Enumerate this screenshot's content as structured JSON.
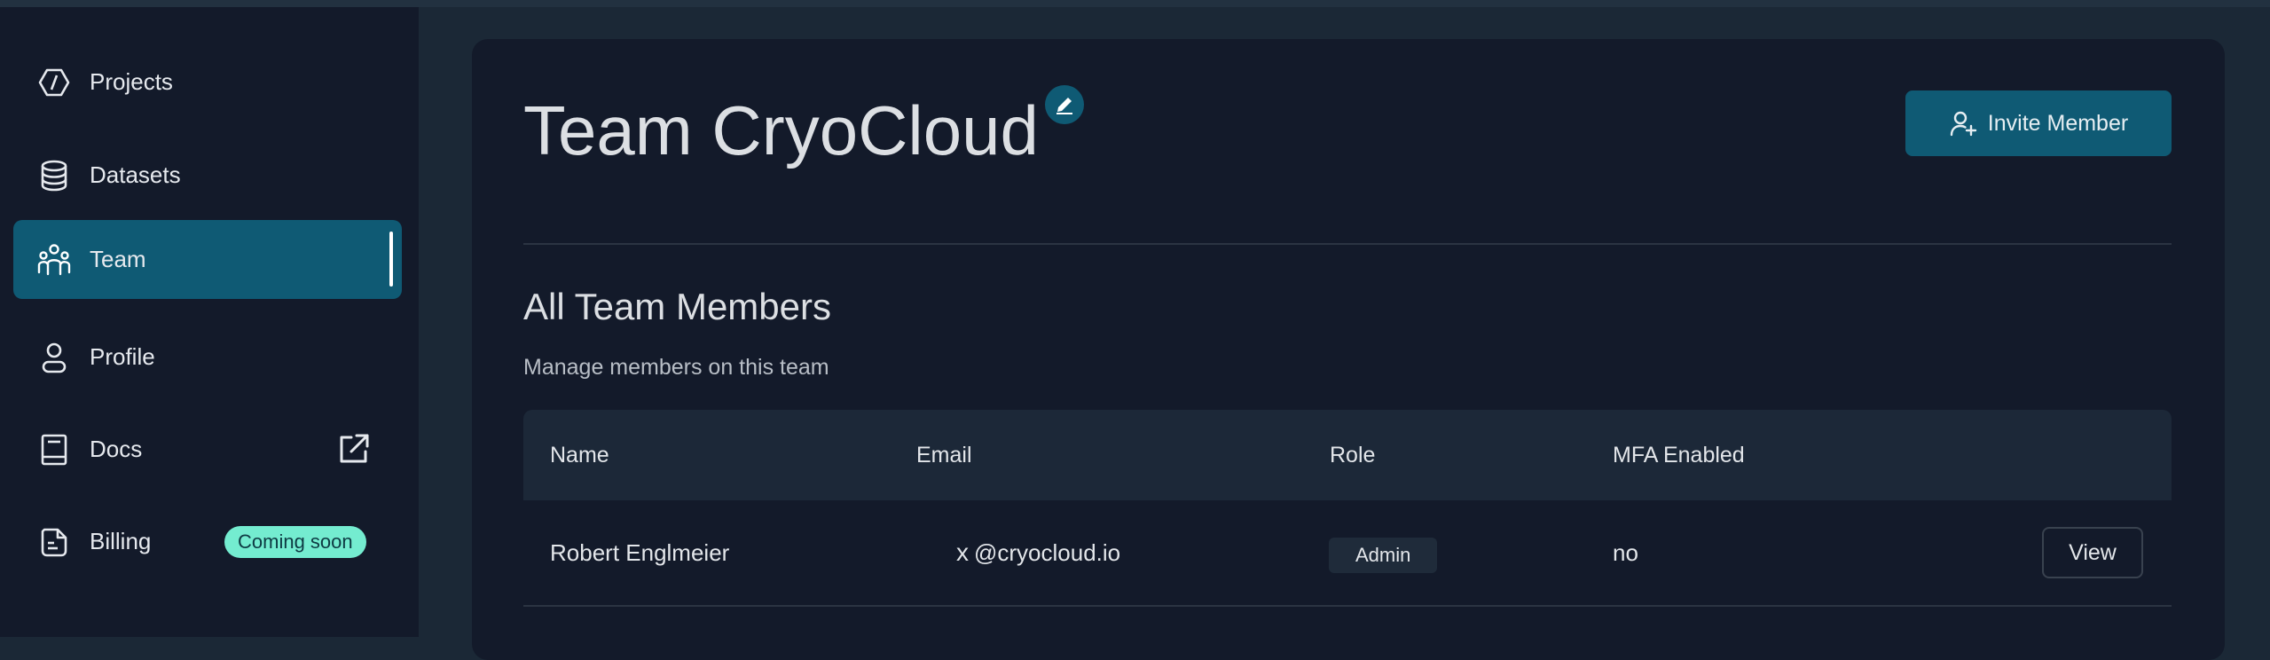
{
  "sidebar": {
    "items": [
      {
        "label": "Projects",
        "icon": "projects-icon",
        "active": false
      },
      {
        "label": "Datasets",
        "icon": "database-icon",
        "active": false
      },
      {
        "label": "Team",
        "icon": "team-icon",
        "active": true
      },
      {
        "label": "Profile",
        "icon": "user-icon",
        "active": false
      },
      {
        "label": "Docs",
        "icon": "book-icon",
        "active": false,
        "trailing_icon": "external-link-icon"
      },
      {
        "label": "Billing",
        "icon": "billing-icon",
        "active": false,
        "badge": "Coming soon"
      }
    ]
  },
  "header": {
    "title": "Team CryoCloud",
    "edit_icon": "pencil-icon",
    "invite_label": "Invite Member",
    "invite_icon": "user-plus-icon"
  },
  "members": {
    "title": "All Team Members",
    "subtitle": "Manage members on this team",
    "columns": [
      "Name",
      "Email",
      "Role",
      "MFA Enabled"
    ],
    "rows": [
      {
        "name": "Robert Englmeier",
        "email_prefix": "x",
        "email": "@cryocloud.io",
        "role": "Admin",
        "mfa": "no",
        "action": "View"
      }
    ]
  },
  "colors": {
    "accent": "#0f5a74",
    "badge": "#74ecd0",
    "panel": "#131a2a",
    "background": "#1b2836"
  }
}
